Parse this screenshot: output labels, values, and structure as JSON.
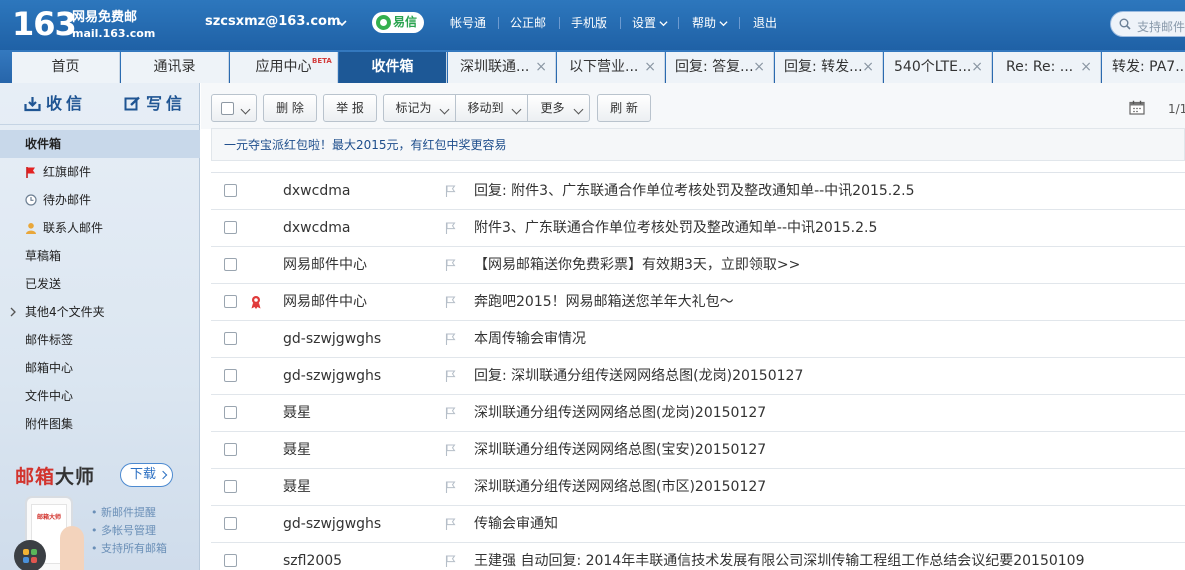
{
  "header": {
    "logo_number": "163",
    "logo_name": "网易免费邮",
    "logo_url": "mail.163.com",
    "account": "szcsxmz@163.com",
    "yixin": "易信",
    "nav": [
      "帐号通",
      "公正邮",
      "手机版",
      "设置",
      "帮助",
      "退出"
    ],
    "search_placeholder": "支持邮件"
  },
  "tabs": [
    {
      "label": "首页"
    },
    {
      "label": "通讯录"
    },
    {
      "label": "应用中心",
      "badge": "BETA"
    },
    {
      "label": "收件箱",
      "active": true
    },
    {
      "label": "深圳联通...",
      "close": "×"
    },
    {
      "label": "以下营业...",
      "close": "×"
    },
    {
      "label": "回复: 答复...",
      "close": "×"
    },
    {
      "label": "回复: 转发...",
      "close": "×"
    },
    {
      "label": "540个LTE...",
      "close": "×"
    },
    {
      "label": "Re: Re: ...",
      "close": "×"
    },
    {
      "label": "转发: PA7..."
    }
  ],
  "sidebar": {
    "receive": "收信",
    "write": "写信",
    "folders": [
      {
        "label": "收件箱",
        "active": true
      },
      {
        "label": "红旗邮件",
        "icon": "red-flag-icon"
      },
      {
        "label": "待办邮件",
        "icon": "clock-icon"
      },
      {
        "label": "联系人邮件",
        "icon": "contact-icon"
      },
      {
        "label": "草稿箱"
      },
      {
        "label": "已发送"
      },
      {
        "label": "其他4个文件夹",
        "expandable": true
      },
      {
        "label": "邮件标签"
      },
      {
        "label": "邮箱中心"
      },
      {
        "label": "文件中心"
      },
      {
        "label": "附件图集"
      }
    ],
    "promo": {
      "title_red": "邮箱",
      "title_black": "大师",
      "download": "下载",
      "phone_app": "邮箱大师",
      "features": [
        "新邮件提醒",
        "多帐号管理",
        "支持所有邮箱"
      ]
    }
  },
  "toolbar": {
    "delete": "删 除",
    "report": "举 报",
    "mark_as": "标记为",
    "move_to": "移动到",
    "more": "更多",
    "refresh": "刷 新",
    "pager": "1/1"
  },
  "notice": "一元夺宝派红包啦！最大2015元，有红包中奖更容易",
  "emails": [
    {
      "sender": "dxwcdma",
      "subject": "回复: 附件3、广东联通合作单位考核处罚及整改通知单--中讯2015.2.5"
    },
    {
      "sender": "dxwcdma",
      "subject": "附件3、广东联通合作单位考核处罚及整改通知单--中讯2015.2.5"
    },
    {
      "sender": "网易邮件中心",
      "subject": "【网易邮箱送你免费彩票】有效期3天，立即领取>>"
    },
    {
      "sender": "网易邮件中心",
      "subject": "奔跑吧2015！网易邮箱送您羊年大礼包～",
      "badge": "ribbon-icon"
    },
    {
      "sender": "gd-szwjgwghs",
      "subject": "本周传输会审情况"
    },
    {
      "sender": "gd-szwjgwghs",
      "subject": "回复: 深圳联通分组传送网网络总图(龙岗)20150127"
    },
    {
      "sender": "聂星",
      "subject": "深圳联通分组传送网网络总图(龙岗)20150127"
    },
    {
      "sender": "聂星",
      "subject": "深圳联通分组传送网网络总图(宝安)20150127"
    },
    {
      "sender": "聂星",
      "subject": "深圳联通分组传送网网络总图(市区)20150127"
    },
    {
      "sender": "gd-szwjgwghs",
      "subject": "传输会审通知"
    },
    {
      "sender": "szfl2005",
      "subject": "王建强 自动回复: 2014年丰联通信技术发展有限公司深圳传输工程组工作总结会议纪要20150109"
    }
  ]
}
